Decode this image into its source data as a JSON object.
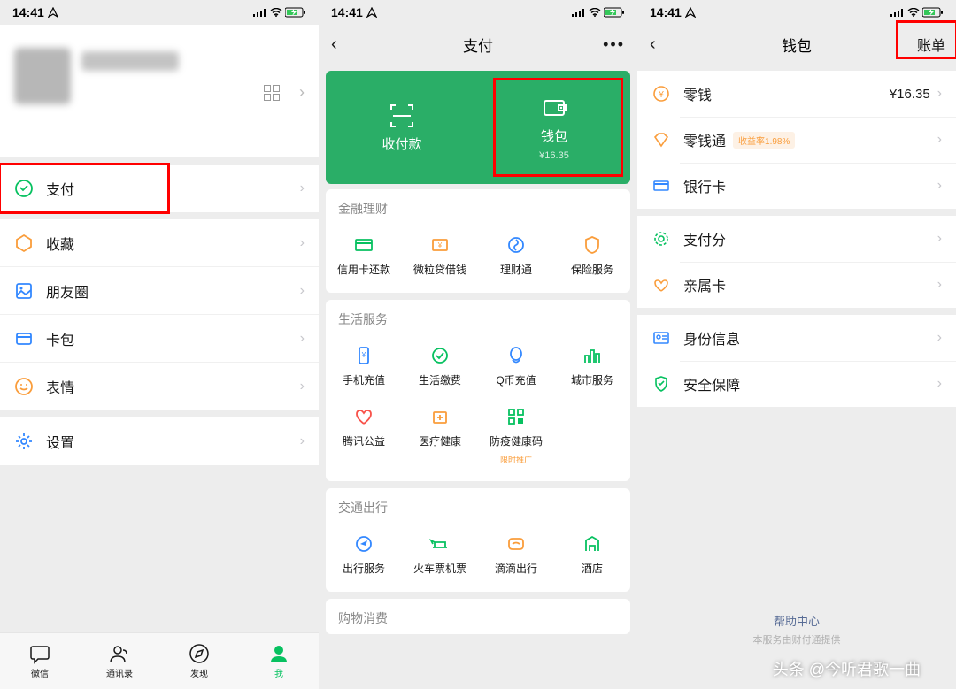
{
  "status": {
    "time": "14:41"
  },
  "phone1": {
    "menu": {
      "pay": "支付",
      "favorites": "收藏",
      "moments": "朋友圈",
      "cards": "卡包",
      "stickers": "表情",
      "settings": "设置"
    },
    "tabs": {
      "wechat": "微信",
      "contacts": "通讯录",
      "discover": "发现",
      "me": "我"
    }
  },
  "phone2": {
    "title": "支付",
    "green": {
      "pay_receive": "收付款",
      "wallet": "钱包",
      "balance": "¥16.35"
    },
    "sections": {
      "finance": "金融理财",
      "life": "生活服务",
      "transport": "交通出行",
      "shopping": "购物消费"
    },
    "finance_items": [
      "信用卡还款",
      "微粒贷借钱",
      "理财通",
      "保险服务"
    ],
    "life_items": [
      "手机充值",
      "生活缴费",
      "Q币充值",
      "城市服务",
      "腾讯公益",
      "医疗健康",
      "防疫健康码"
    ],
    "life_sub": "限时推广",
    "transport_items": [
      "出行服务",
      "火车票机票",
      "滴滴出行",
      "酒店"
    ]
  },
  "phone3": {
    "title": "钱包",
    "bills": "账单",
    "items": {
      "balance": {
        "label": "零钱",
        "value": "¥16.35"
      },
      "lqt": {
        "label": "零钱通",
        "badge": "收益率1.98%"
      },
      "bank": "银行卡",
      "score": "支付分",
      "family": "亲属卡",
      "identity": "身份信息",
      "security": "安全保障"
    },
    "help": "帮助中心",
    "help_sub": "本服务由财付通提供"
  },
  "watermark": "头条 @今听君歌一曲"
}
